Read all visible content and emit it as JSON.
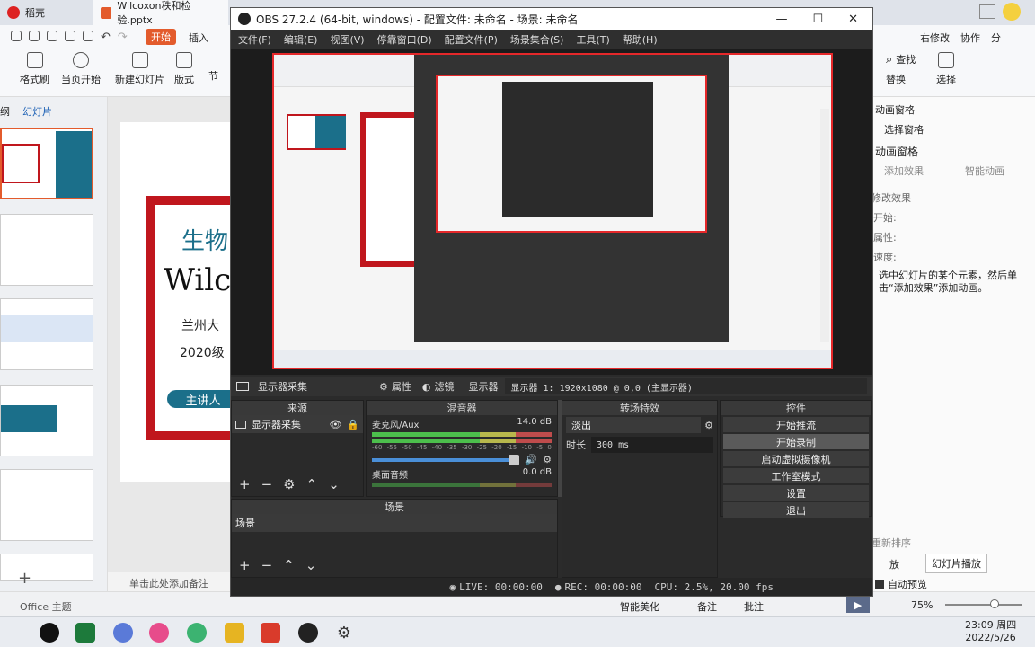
{
  "wps": {
    "tabs": [
      {
        "label": "稻壳"
      },
      {
        "label": "Wilcoxon秩和检验.pptx"
      }
    ],
    "start_btn": "开始",
    "insert_tab": "插入",
    "share_actions": [
      "右修改",
      "协作",
      "分"
    ],
    "toolbar": {
      "format_brush": "格式刷",
      "play_from_current": "当页开始",
      "new_slide": "新建幻灯片",
      "layout": "版式",
      "section": "节",
      "find": "查找",
      "replace": "替换",
      "select": "选择"
    },
    "left_tabs": [
      "纲",
      "幻灯片"
    ],
    "slide_preview": {
      "title_cn": "生物",
      "title_en": "Wilco",
      "university": "兰州大",
      "grade": "2020级",
      "speaker": "主讲人"
    },
    "right_panel": {
      "anim_pane": "动画窗格",
      "select_pane": "选择窗格",
      "anim_title": "动画窗格",
      "add_effect": "添加效果",
      "smart_anim": "智能动画",
      "modify_effect": "修改效果",
      "start_label": "开始:",
      "property_label": "属性:",
      "speed_label": "速度:",
      "hint": "选中幻灯片的某个元素，然后单击“添加效果”添加动画。",
      "reorder": "重新排序",
      "play": "放",
      "slideshow": "幻灯片播放",
      "autopreview": "自动预览"
    },
    "status": {
      "notes_placeholder": "单击此处添加备注",
      "office_theme": "Office 主题",
      "smart_beautify": "智能美化",
      "notes": "备注",
      "comments": "批注",
      "zoom": "75%"
    },
    "taskbar": {
      "time": "23:09 周四",
      "date": "2022/5/26"
    }
  },
  "obs": {
    "title": "OBS 27.2.4 (64-bit, windows) - 配置文件: 未命名 - 场景: 未命名",
    "menu": [
      "文件(F)",
      "编辑(E)",
      "视图(V)",
      "停靠窗口(D)",
      "配置文件(P)",
      "场景集合(S)",
      "工具(T)",
      "帮助(H)"
    ],
    "source_bar": {
      "source_name": "显示器采集",
      "properties": "属性",
      "filters": "滤镜",
      "display_label": "显示器",
      "display_value": "显示器 1: 1920x1080 @ 0,0 (主显示器)"
    },
    "sources_head": "来源",
    "sources": [
      {
        "name": "显示器采集"
      }
    ],
    "mixer_head": "混音器",
    "mixer": [
      {
        "name": "麦克风/Aux",
        "db": "14.0 dB"
      },
      {
        "name": "桌面音频",
        "db": "0.0 dB"
      }
    ],
    "mixer_ticks": [
      "-60",
      "-55",
      "-50",
      "-45",
      "-40",
      "-35",
      "-30",
      "-25",
      "-20",
      "-15",
      "-10",
      "-5",
      "0"
    ],
    "transitions_head": "转场特效",
    "transition_value": "淡出",
    "duration_label": "时长",
    "duration_value": "300 ms",
    "controls_head": "控件",
    "controls": [
      "开始推流",
      "开始录制",
      "启动虚拟摄像机",
      "工作室模式",
      "设置",
      "退出"
    ],
    "scenes_head": "场景",
    "scenes": [
      {
        "name": "场景"
      }
    ],
    "status": {
      "live": "LIVE: 00:00:00",
      "rec": "REC: 00:00:00",
      "cpu": "CPU: 2.5%, 20.00 fps"
    }
  },
  "colors": {
    "obs_accent": "#e5282a",
    "wps_accent": "#e35b2c",
    "slide_red": "#c0161d",
    "slide_teal": "#1b6f8a"
  }
}
